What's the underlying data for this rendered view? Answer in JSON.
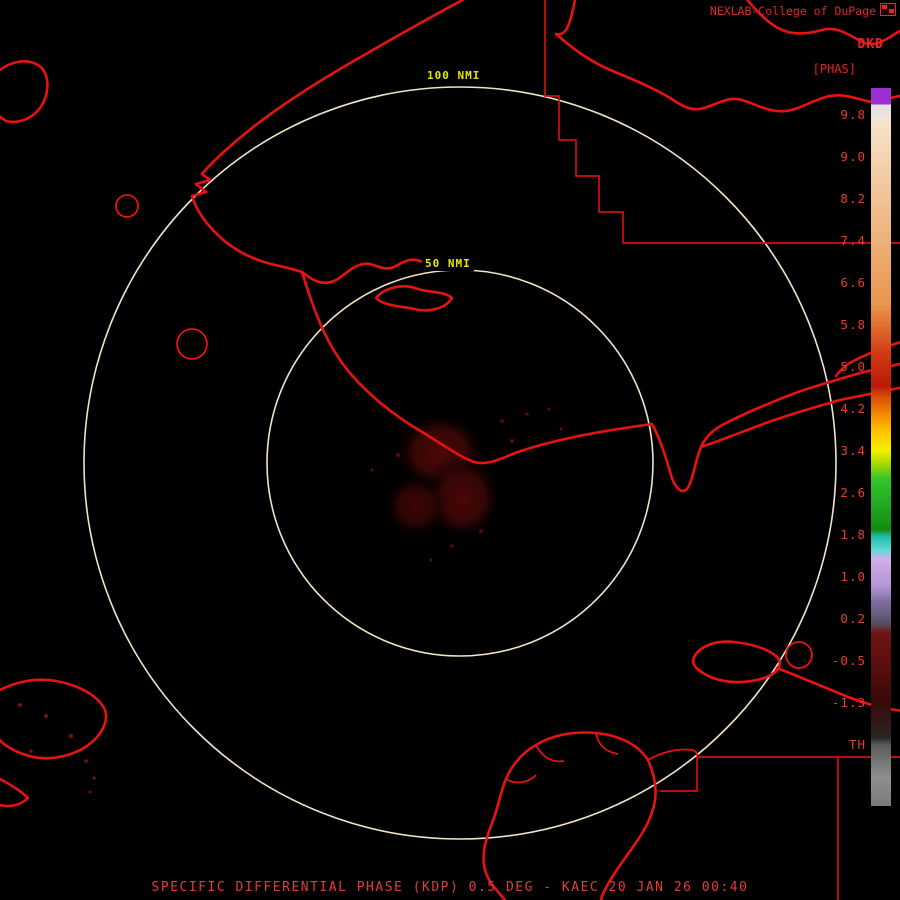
{
  "header": {
    "brand": "NEXLAB-College of DuPage",
    "product_code": "DKD",
    "units": "[PHAS]"
  },
  "rings": {
    "outer_label": "100 NMI",
    "inner_label": "50 NMI"
  },
  "colorbar": {
    "ticks": [
      "9.8",
      "9.0",
      "8.2",
      "7.4",
      "6.6",
      "5.8",
      "5.0",
      "4.2",
      "3.4",
      "2.6",
      "1.8",
      "1.0",
      "0.2",
      "-0.5",
      "-1.3",
      "TH"
    ],
    "stops": [
      {
        "pos": 0.0,
        "color": "#9b2fd0"
      },
      {
        "pos": 2.3,
        "color": "#9b2fd0"
      },
      {
        "pos": 2.3,
        "color": "#e2dee2"
      },
      {
        "pos": 4.6,
        "color": "#eee6dc"
      },
      {
        "pos": 4.6,
        "color": "#f6e4cb"
      },
      {
        "pos": 30.0,
        "color": "#e9964e"
      },
      {
        "pos": 33.0,
        "color": "#e2702f"
      },
      {
        "pos": 37.0,
        "color": "#d13a14"
      },
      {
        "pos": 41.5,
        "color": "#bb1a0a"
      },
      {
        "pos": 43.0,
        "color": "#d84e0a"
      },
      {
        "pos": 45.5,
        "color": "#f58a00"
      },
      {
        "pos": 48.0,
        "color": "#ffc800"
      },
      {
        "pos": 50.5,
        "color": "#f4f000"
      },
      {
        "pos": 52.5,
        "color": "#9ed800"
      },
      {
        "pos": 54.5,
        "color": "#34c42c"
      },
      {
        "pos": 58.0,
        "color": "#22aa22"
      },
      {
        "pos": 61.5,
        "color": "#138a13"
      },
      {
        "pos": 62.5,
        "color": "#1fbfae"
      },
      {
        "pos": 64.5,
        "color": "#66dada"
      },
      {
        "pos": 65.5,
        "color": "#cfb0ea"
      },
      {
        "pos": 69.5,
        "color": "#b394d6"
      },
      {
        "pos": 71.5,
        "color": "#7f6fa0"
      },
      {
        "pos": 74.5,
        "color": "#565066"
      },
      {
        "pos": 76.0,
        "color": "#711313"
      },
      {
        "pos": 80.0,
        "color": "#5c0f0f"
      },
      {
        "pos": 85.5,
        "color": "#380909"
      },
      {
        "pos": 90.5,
        "color": "#2c2424"
      },
      {
        "pos": 91.5,
        "color": "#5a5a5a"
      },
      {
        "pos": 96.0,
        "color": "#8f8f8f"
      },
      {
        "pos": 100.0,
        "color": "#7a7a7a"
      }
    ]
  },
  "footer": {
    "caption": "SPECIFIC DIFFERENTIAL PHASE (KDP) 0.5 DEG - KAEC 20 JAN 26 00:40"
  },
  "colors": {
    "background": "#000000",
    "map_outline": "#e81212",
    "boundary_line": "#d01010",
    "range_ring": "#f1e3c6",
    "ring_label": "#e6e600",
    "header_text": "#e02626",
    "tick_text": "#e04028",
    "footer_text": "#e23c3c",
    "echo": "#5a0a0a"
  }
}
